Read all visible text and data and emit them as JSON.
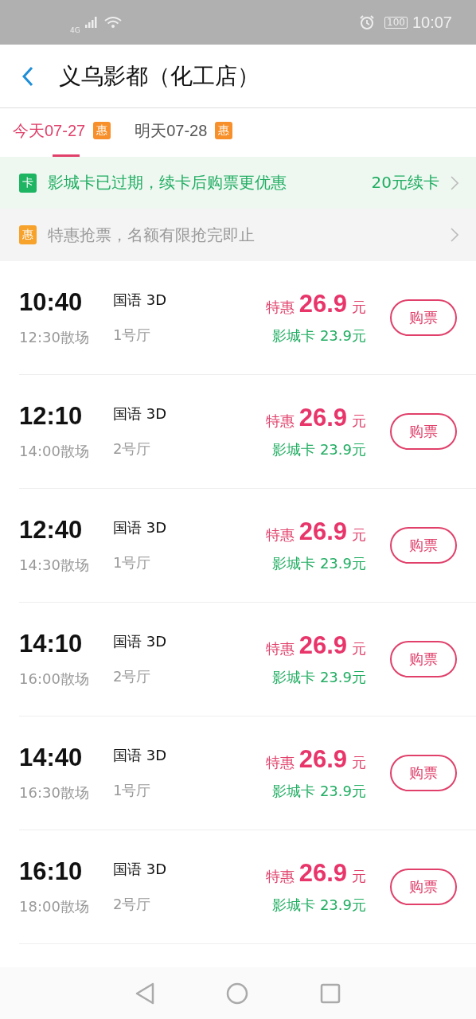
{
  "status_bar": {
    "network": "4G",
    "battery": "100",
    "time": "10:07"
  },
  "header": {
    "title": "义乌影都（化工店）"
  },
  "tabs": [
    {
      "label": "今天07-27",
      "badge": "惠",
      "selected": true
    },
    {
      "label": "明天07-28",
      "badge": "惠",
      "selected": false
    }
  ],
  "banners": [
    {
      "kind": "card",
      "badge": "卡",
      "text": "影城卡已过期，续卡后购票更优惠",
      "action": "20元续卡"
    },
    {
      "kind": "promo",
      "badge": "惠",
      "text": "特惠抢票，名额有限抢完即止"
    }
  ],
  "showtimes": [
    {
      "start": "10:40",
      "end": "12:30散场",
      "language": "国语 3D",
      "hall": "1号厅",
      "price_label": "特惠",
      "price": "26.9",
      "unit": "元",
      "card_price": "影城卡 23.9元",
      "button": "购票"
    },
    {
      "start": "12:10",
      "end": "14:00散场",
      "language": "国语 3D",
      "hall": "2号厅",
      "price_label": "特惠",
      "price": "26.9",
      "unit": "元",
      "card_price": "影城卡 23.9元",
      "button": "购票"
    },
    {
      "start": "12:40",
      "end": "14:30散场",
      "language": "国语 3D",
      "hall": "1号厅",
      "price_label": "特惠",
      "price": "26.9",
      "unit": "元",
      "card_price": "影城卡 23.9元",
      "button": "购票"
    },
    {
      "start": "14:10",
      "end": "16:00散场",
      "language": "国语 3D",
      "hall": "2号厅",
      "price_label": "特惠",
      "price": "26.9",
      "unit": "元",
      "card_price": "影城卡 23.9元",
      "button": "购票"
    },
    {
      "start": "14:40",
      "end": "16:30散场",
      "language": "国语 3D",
      "hall": "1号厅",
      "price_label": "特惠",
      "price": "26.9",
      "unit": "元",
      "card_price": "影城卡 23.9元",
      "button": "购票"
    },
    {
      "start": "16:10",
      "end": "18:00散场",
      "language": "国语 3D",
      "hall": "2号厅",
      "price_label": "特惠",
      "price": "26.9",
      "unit": "元",
      "card_price": "影城卡 23.9元",
      "button": "购票"
    }
  ]
}
